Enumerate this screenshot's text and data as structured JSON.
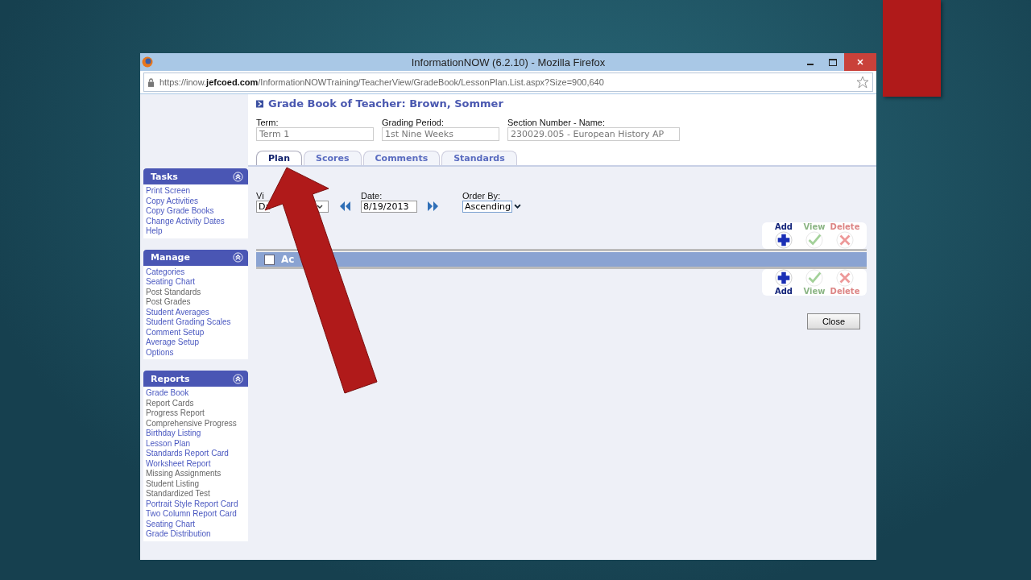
{
  "window": {
    "title": "InformationNOW (6.2.10) - Mozilla Firefox",
    "url_prefix": "https://inow.",
    "url_domain": "jefcoed.com",
    "url_rest": "/InformationNOWTraining/TeacherView/GradeBook/LessonPlan.List.aspx?Size=900,640"
  },
  "page_title": "Grade Book of Teacher: Brown, Sommer",
  "fields": [
    {
      "label": "Term:",
      "value": "Term 1"
    },
    {
      "label": "Grading Period:",
      "value": "1st Nine Weeks"
    },
    {
      "label": "Section Number - Name:",
      "value": "230029.005 - European History AP"
    }
  ],
  "tabs": [
    {
      "label": "Plan",
      "selected": true
    },
    {
      "label": "Scores",
      "selected": false
    },
    {
      "label": "Comments",
      "selected": false
    },
    {
      "label": "Standards",
      "selected": false
    }
  ],
  "sidebar": [
    {
      "title": "Tasks",
      "items": [
        {
          "label": "Print Screen",
          "disabled": false
        },
        {
          "label": "Copy Activities",
          "disabled": false
        },
        {
          "label": "Copy Grade Books",
          "disabled": false
        },
        {
          "label": "Change Activity Dates",
          "disabled": false
        },
        {
          "label": "Help",
          "disabled": false
        }
      ]
    },
    {
      "title": "Manage",
      "items": [
        {
          "label": "Categories",
          "disabled": false
        },
        {
          "label": "Seating Chart",
          "disabled": false
        },
        {
          "label": "Post Standards",
          "disabled": true
        },
        {
          "label": "Post Grades",
          "disabled": true
        },
        {
          "label": "Student Averages",
          "disabled": false
        },
        {
          "label": "Student Grading Scales",
          "disabled": false
        },
        {
          "label": "Comment Setup",
          "disabled": false
        },
        {
          "label": "Average Setup",
          "disabled": false
        },
        {
          "label": "Options",
          "disabled": false
        }
      ]
    },
    {
      "title": "Reports",
      "items": [
        {
          "label": "Grade Book",
          "disabled": false
        },
        {
          "label": "Report Cards",
          "disabled": true
        },
        {
          "label": "Progress Report",
          "disabled": true
        },
        {
          "label": "Comprehensive Progress",
          "disabled": true
        },
        {
          "label": "Birthday Listing",
          "disabled": false
        },
        {
          "label": "Lesson Plan",
          "disabled": false
        },
        {
          "label": "Standards Report Card",
          "disabled": false
        },
        {
          "label": "Worksheet Report",
          "disabled": false
        },
        {
          "label": "Missing Assignments",
          "disabled": true
        },
        {
          "label": "Student Listing",
          "disabled": true
        },
        {
          "label": "Standardized Test",
          "disabled": true
        },
        {
          "label": "Portrait Style Report Card",
          "disabled": false
        },
        {
          "label": "Two Column Report Card",
          "disabled": false
        },
        {
          "label": "Seating Chart",
          "disabled": false
        },
        {
          "label": "Grade Distribution",
          "disabled": false
        }
      ]
    }
  ],
  "filters": {
    "view_label": "Vi",
    "view_value": "Da",
    "date_label": "Date:",
    "date_value": "8/19/2013",
    "order_label": "Order By:",
    "order_value": "Ascending"
  },
  "actions_top": [
    {
      "kind": "add",
      "label": "Add",
      "disabled": false
    },
    {
      "kind": "view",
      "label": "View",
      "disabled": true
    },
    {
      "kind": "delete",
      "label": "Delete",
      "disabled": true
    }
  ],
  "grid": {
    "header": "Ac",
    "checked": false
  },
  "actions_bottom": [
    {
      "kind": "add",
      "label": "Add",
      "disabled": false
    },
    {
      "kind": "view",
      "label": "View",
      "disabled": true
    },
    {
      "kind": "delete",
      "label": "Delete",
      "disabled": true
    }
  ],
  "close_button": "Close"
}
